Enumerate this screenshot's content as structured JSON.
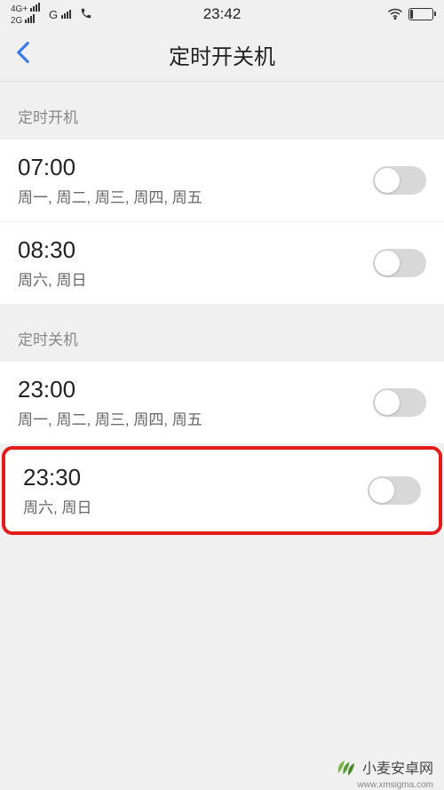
{
  "statusbar": {
    "signal1_label": "4G+",
    "signal2_label": "2G",
    "signal3_label": "G",
    "time": "23:42"
  },
  "header": {
    "title": "定时开关机"
  },
  "sections": {
    "poweron": {
      "title": "定时开机",
      "items": [
        {
          "time": "07:00",
          "days": "周一, 周二, 周三, 周四, 周五"
        },
        {
          "time": "08:30",
          "days": "周六, 周日"
        }
      ]
    },
    "poweroff": {
      "title": "定时关机",
      "items": [
        {
          "time": "23:00",
          "days": "周一, 周二, 周三, 周四, 周五"
        },
        {
          "time": "23:30",
          "days": "周六, 周日"
        }
      ]
    }
  },
  "watermark": {
    "text": "小麦安卓网",
    "url": "www.xmsigma.com"
  }
}
